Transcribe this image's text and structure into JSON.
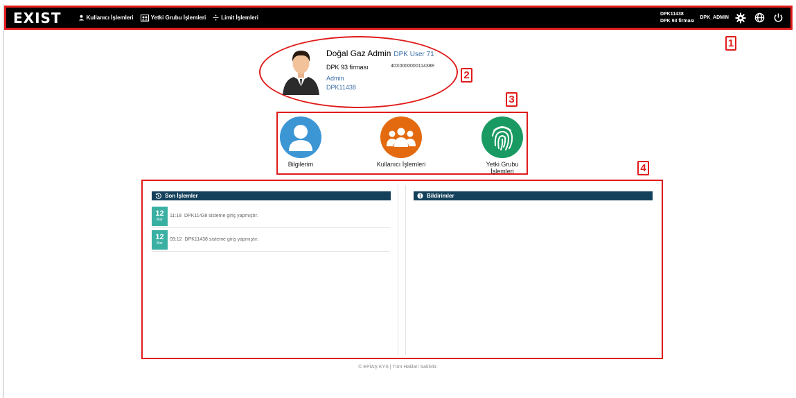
{
  "nav": {
    "brand": "EXIST",
    "items": [
      {
        "label": "Kullanıcı İşlemleri",
        "icon": "user-icon"
      },
      {
        "label": "Yetki Grubu İşlemleri",
        "icon": "group-settings-icon"
      },
      {
        "label": "Limit İşlemleri",
        "icon": "divide-icon"
      }
    ],
    "user_id": "DPK11438",
    "user_firm": "DPK 93 firması",
    "role": "DPK_ADMIN",
    "icons": [
      "gear-icon",
      "globe-icon",
      "power-icon"
    ]
  },
  "profile": {
    "name": "Doğal Gaz Admin",
    "user_label": "DPK User 71",
    "firm": "DPK 93 firması",
    "code": "40X000000011438E",
    "role": "Admin",
    "user_id": "DPK11438"
  },
  "shortcuts": [
    {
      "label": "Bilgilerim",
      "icon": "person-icon",
      "color": "#3c96d4"
    },
    {
      "label": "Kullanıcı İşlemleri",
      "icon": "users-icon",
      "color": "#e36a0f"
    },
    {
      "label": "Yetki Grubu",
      "label2": "İşlemleri",
      "icon": "fingerprint-icon",
      "color": "#1a9a63"
    }
  ],
  "recent": {
    "title": "Son İşlemler",
    "items": [
      {
        "day": "12",
        "month": "Mar",
        "time": "11:18",
        "text": "DPK11438 sisteme giriş yapmıştır."
      },
      {
        "day": "12",
        "month": "Mar",
        "time": "09:12",
        "text": "DPK11438 sisteme giriş yapmıştır."
      }
    ]
  },
  "notifications": {
    "title": "Bildirimler"
  },
  "footer": "© EPİAŞ KYS | Tüm Hakları Saklıdır.",
  "callouts": [
    "1",
    "2",
    "3",
    "4"
  ],
  "colors": {
    "nav_bg": "#000000",
    "annotation": "#e01b1b",
    "panel_header": "#13405a",
    "date_badge": "#3ab0a3"
  }
}
